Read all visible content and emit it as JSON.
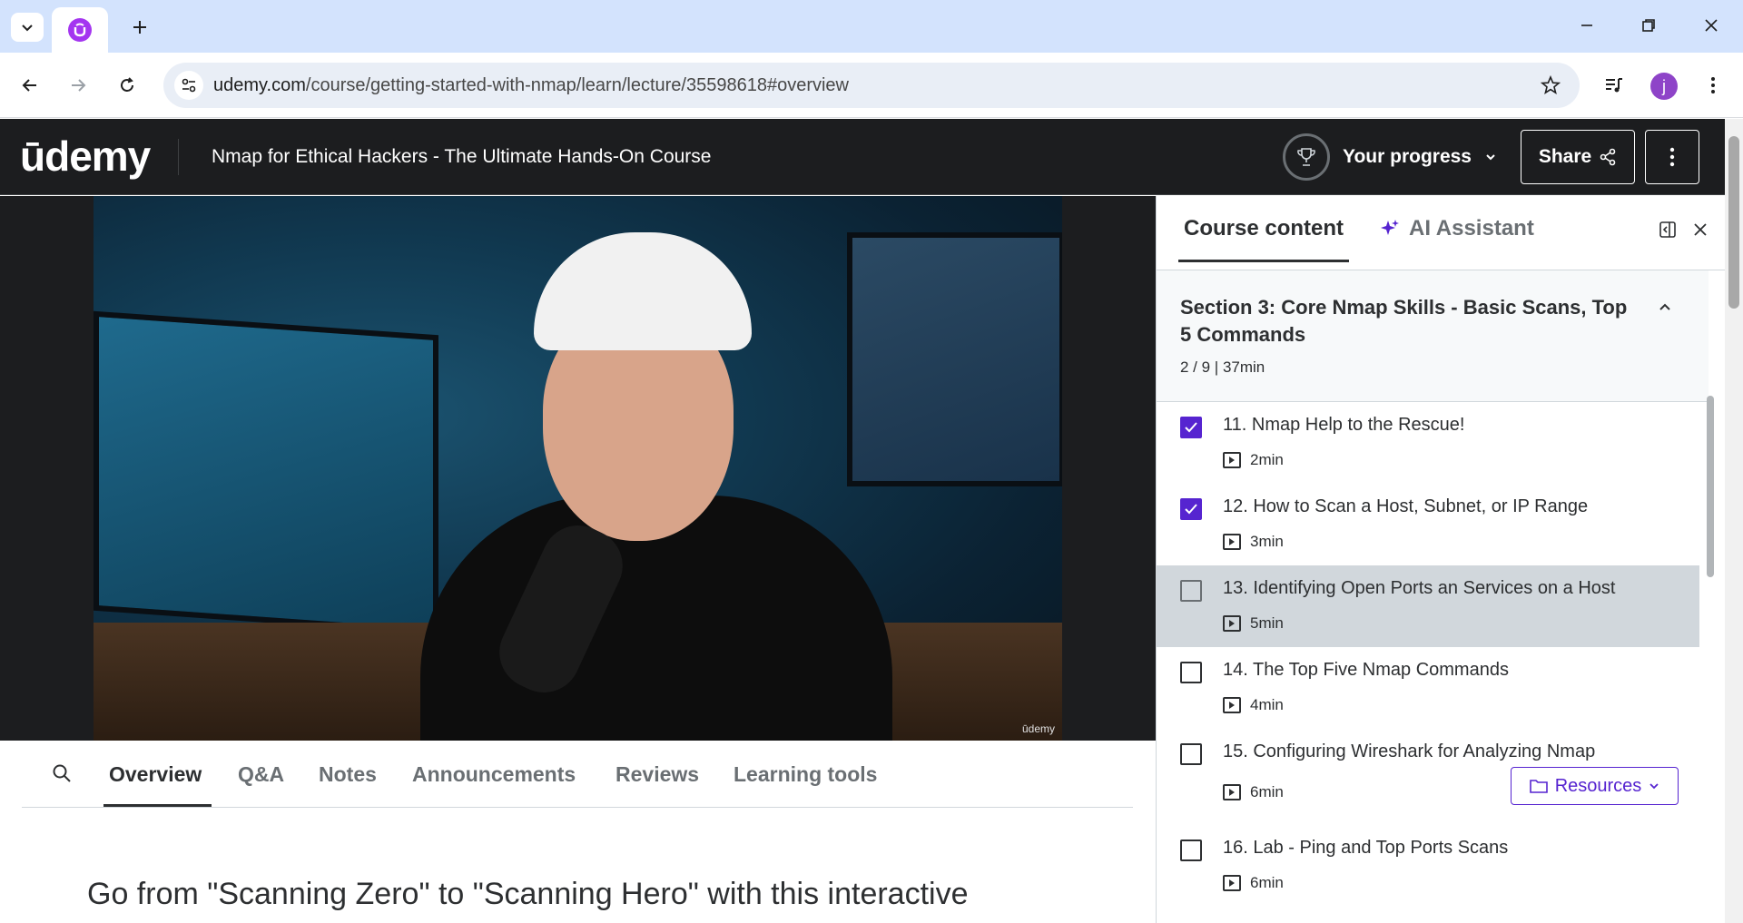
{
  "browser": {
    "url_domain": "udemy.com",
    "url_path": "/course/getting-started-with-nmap/learn/lecture/35598618#overview"
  },
  "header": {
    "logo": "ūdemy",
    "course_title": "Nmap for Ethical Hackers - The Ultimate Hands-On Course",
    "progress_label": "Your progress",
    "share_label": "Share"
  },
  "video": {
    "watermark": "ūdemy"
  },
  "tabs": [
    {
      "label": "Overview"
    },
    {
      "label": "Q&A"
    },
    {
      "label": "Notes"
    },
    {
      "label": "Announcements"
    },
    {
      "label": "Reviews"
    },
    {
      "label": "Learning tools"
    }
  ],
  "overview": {
    "heading": "Go from \"Scanning Zero\" to \"Scanning Hero\" with this interactive"
  },
  "sidebar": {
    "tab_course_content": "Course content",
    "tab_ai_assistant": "AI Assistant",
    "section_title": "Section 3: Core Nmap Skills - Basic Scans, Top 5 Commands",
    "section_meta": "2 / 9 | 37min",
    "lectures": [
      {
        "title": "11. Nmap Help to the Rescue!",
        "duration": "2min",
        "completed": true
      },
      {
        "title": "12. How to Scan a Host, Subnet, or IP Range",
        "duration": "3min",
        "completed": true
      },
      {
        "title": "13. Identifying Open Ports an Services on a Host",
        "duration": "5min",
        "completed": false,
        "current": true
      },
      {
        "title": "14. The Top Five Nmap Commands",
        "duration": "4min",
        "completed": false
      },
      {
        "title": "15. Configuring Wireshark for Analyzing Nmap",
        "duration": "6min",
        "completed": false,
        "resources_label": "Resources"
      },
      {
        "title": "16. Lab - Ping and Top Ports Scans",
        "duration": "6min",
        "completed": false
      }
    ]
  },
  "colors": {
    "accent": "#5624d0",
    "brand": "#a435f0",
    "header_bg": "#1c1d1f"
  }
}
